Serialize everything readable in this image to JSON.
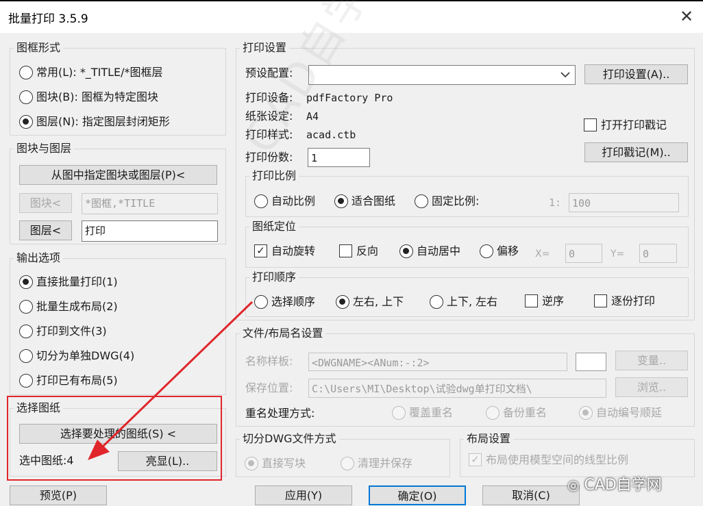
{
  "window": {
    "title": "批量打印 3.5.9",
    "close_glyph": "✕"
  },
  "frame_type": {
    "label": "图框形式",
    "options": [
      {
        "label": "常用(L): *_TITLE/*图框层",
        "selected": false
      },
      {
        "label": "图块(B): 图框为特定图块",
        "selected": false
      },
      {
        "label": "图层(N): 指定图层封闭矩形",
        "selected": true
      }
    ]
  },
  "block_layer": {
    "label": "图块与图层",
    "pick_button": "从图中指定图块或图层(P)<",
    "block_button": "图块<",
    "block_value": "*图框,*TITLE",
    "layer_button": "图层<",
    "layer_value": "打印"
  },
  "output": {
    "label": "输出选项",
    "options": [
      {
        "label": "直接批量打印(1)",
        "selected": true
      },
      {
        "label": "批量生成布局(2)",
        "selected": false
      },
      {
        "label": "打印到文件(3)",
        "selected": false
      },
      {
        "label": "切分为单独DWG(4)",
        "selected": false
      },
      {
        "label": "打印已有布局(5)",
        "selected": false
      }
    ]
  },
  "select_drawings": {
    "label": "选择图纸",
    "select_button": "选择要处理的图纸(S) <",
    "count_label": "选中图纸:4",
    "highlight_button": "亮显(L).."
  },
  "bottom_buttons": {
    "preview": "预览(P)",
    "apply": "应用(Y)",
    "ok": "确定(O)",
    "cancel": "取消(C)"
  },
  "print_settings": {
    "label": "打印设置",
    "preset_label": "预设配置:",
    "preset_value": "",
    "settings_button": "打印设置(A)..",
    "device_label": "打印设备:",
    "device_value": "pdfFactory Pro",
    "paper_label": "纸张设定:",
    "paper_value": "A4",
    "style_label": "打印样式:",
    "style_value": "acad.ctb",
    "stamp_checkbox": "打开打印戳记",
    "stamp_checked": false,
    "stamp_button": "打印戳记(M)..",
    "copies_label": "打印份数:",
    "copies_value": "1"
  },
  "scale": {
    "label": "打印比例",
    "options": [
      {
        "label": "自动比例",
        "selected": false
      },
      {
        "label": "适合图纸",
        "selected": true
      },
      {
        "label": "固定比例:",
        "selected": false
      }
    ],
    "ratio_prefix": "1:",
    "ratio_value": "100"
  },
  "position": {
    "label": "图纸定位",
    "auto_rotate": "自动旋转",
    "auto_rotate_checked": true,
    "reverse": "反向",
    "reverse_checked": false,
    "center": "自动居中",
    "center_selected": true,
    "offset": "偏移",
    "offset_selected": false,
    "x_label": "X=",
    "x_value": "0",
    "y_label": "Y=",
    "y_value": "0"
  },
  "order": {
    "label": "打印顺序",
    "options": [
      {
        "label": "选择顺序",
        "selected": false
      },
      {
        "label": "左右, 上下",
        "selected": true
      },
      {
        "label": "上下, 左右",
        "selected": false
      }
    ],
    "reverse_order": "逆序",
    "reverse_order_checked": false,
    "copy_by_copy": "逐份打印",
    "copy_by_copy_checked": false
  },
  "file_name": {
    "label": "文件/布局名设置",
    "pattern_label": "名称样板:",
    "pattern_value": "<DWGNAME><ANum:-:2>",
    "var_button": "变量..",
    "save_label": "保存位置:",
    "save_value": "C:\\Users\\MI\\Desktop\\试验dwg单打印文档\\",
    "browse_button": "浏览..",
    "dup_label": "重名处理方式:",
    "dup_options": [
      {
        "label": "覆盖重名",
        "selected": false
      },
      {
        "label": "备份重名",
        "selected": false
      },
      {
        "label": "自动编号顺延",
        "selected": true
      }
    ]
  },
  "split_dwg": {
    "label": "切分DWG文件方式",
    "options": [
      {
        "label": "直接写块",
        "selected": true
      },
      {
        "label": "清理并保存",
        "selected": false
      }
    ]
  },
  "layout": {
    "label": "布局设置",
    "model_ltscale": "布局使用模型空间的线型比例",
    "model_ltscale_checked": true
  },
  "overlay": {
    "watermark_text": "CAD自学网 cadzxw.com",
    "logo_text": "CAD自学网",
    "annotation_color": "#e0262b"
  }
}
